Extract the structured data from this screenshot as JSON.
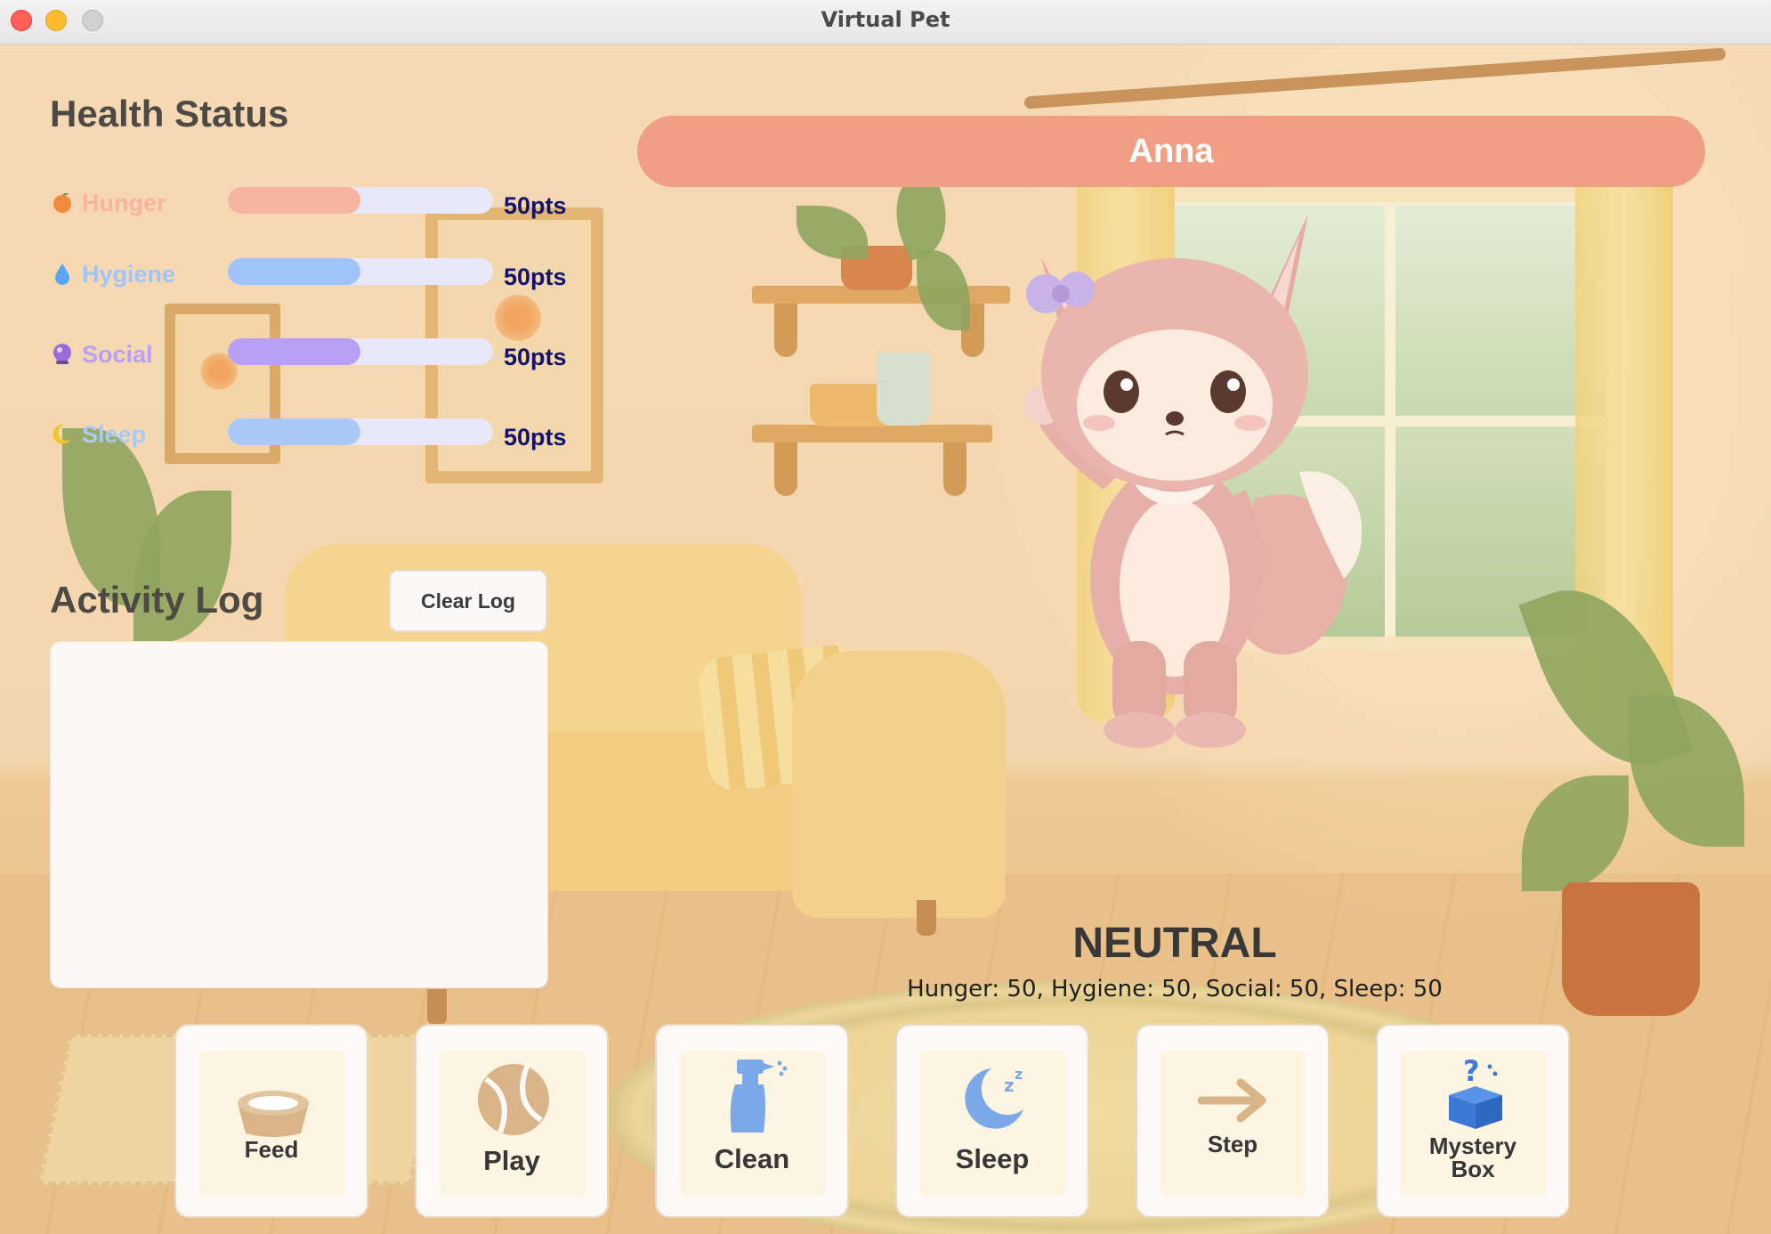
{
  "window": {
    "title": "Virtual Pet"
  },
  "pet": {
    "name": "Anna",
    "mood": "NEUTRAL",
    "stats_line": "Hunger: 50, Hygiene: 50, Social: 50, Sleep: 50"
  },
  "health": {
    "title": "Health Status",
    "stats": [
      {
        "label": "Hunger",
        "value": "50pts",
        "fraction": 0.5,
        "color": "#f7b4a0",
        "icon": "peach-icon"
      },
      {
        "label": "Hygiene",
        "value": "50pts",
        "fraction": 0.5,
        "color": "#a0c4fa",
        "icon": "water-drop-icon"
      },
      {
        "label": "Social",
        "value": "50pts",
        "fraction": 0.5,
        "color": "#b9a0f6",
        "icon": "crystal-ball-icon"
      },
      {
        "label": "Sleep",
        "value": "50pts",
        "fraction": 0.5,
        "color": "#a9c9f7",
        "icon": "crescent-moon-icon"
      }
    ]
  },
  "activity_log": {
    "title": "Activity Log",
    "clear_label": "Clear Log",
    "entries": []
  },
  "actions": [
    {
      "label": "Feed",
      "icon": "food-bowl-icon"
    },
    {
      "label": "Play",
      "icon": "ball-icon"
    },
    {
      "label": "Clean",
      "icon": "spray-bottle-icon"
    },
    {
      "label": "Sleep",
      "icon": "moon-zzz-icon"
    },
    {
      "label": "Step",
      "icon": "arrow-right-icon"
    },
    {
      "label_line1": "Mystery",
      "label_line2": "Box",
      "icon": "mystery-box-icon"
    }
  ]
}
